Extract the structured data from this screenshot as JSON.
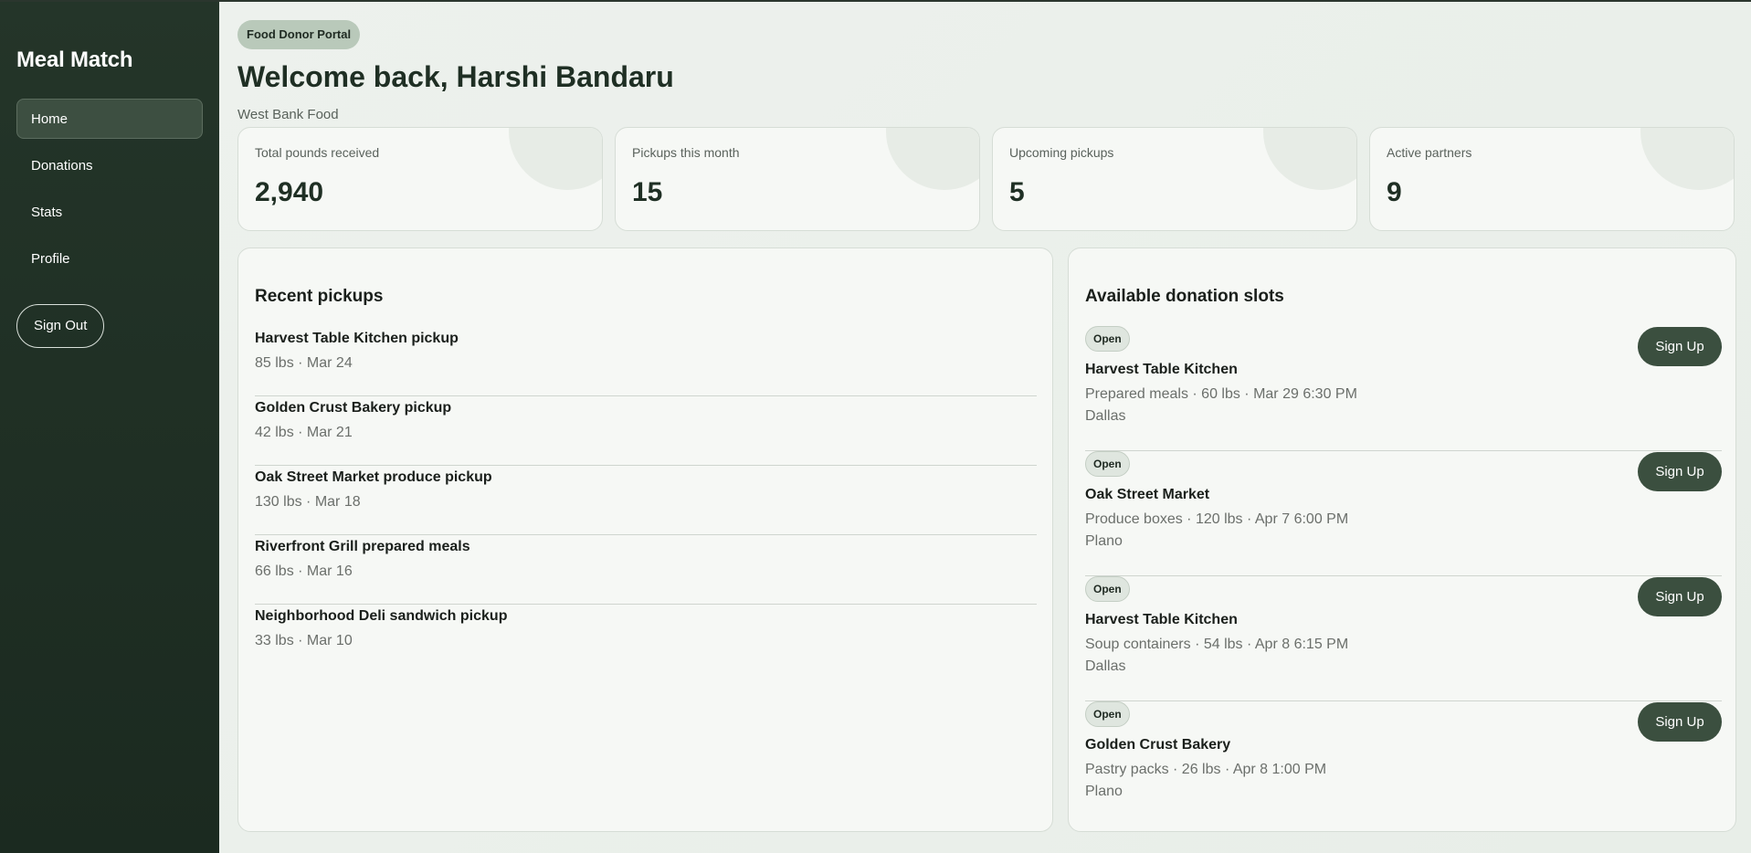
{
  "sidebar": {
    "brand": "Meal Match",
    "nav": [
      {
        "label": "Home"
      },
      {
        "label": "Donations"
      },
      {
        "label": "Stats"
      },
      {
        "label": "Profile"
      }
    ],
    "sign_out": "Sign Out"
  },
  "header": {
    "portal_badge": "Food Donor Portal",
    "welcome": "Welcome back, Harshi Bandaru",
    "organization": "West Bank Food"
  },
  "stats": [
    {
      "label": "Total pounds received",
      "value": "2,940"
    },
    {
      "label": "Pickups this month",
      "value": "15"
    },
    {
      "label": "Upcoming pickups",
      "value": "5"
    },
    {
      "label": "Active partners",
      "value": "9"
    }
  ],
  "recent_pickups": {
    "title": "Recent pickups",
    "items": [
      {
        "title": "Harvest Table Kitchen pickup",
        "meta": "85 lbs · Mar 24"
      },
      {
        "title": "Golden Crust Bakery pickup",
        "meta": "42 lbs · Mar 21"
      },
      {
        "title": "Oak Street Market produce pickup",
        "meta": "130 lbs · Mar 18"
      },
      {
        "title": "Riverfront Grill prepared meals",
        "meta": "66 lbs · Mar 16"
      },
      {
        "title": "Neighborhood Deli sandwich pickup",
        "meta": "33 lbs · Mar 10"
      }
    ]
  },
  "donation_slots": {
    "title": "Available donation slots",
    "items": [
      {
        "status": "Open",
        "name": "Harvest Table Kitchen",
        "detail": "Prepared meals · 60 lbs · Mar 29 6:30 PM",
        "city": "Dallas",
        "action": "Sign Up"
      },
      {
        "status": "Open",
        "name": "Oak Street Market",
        "detail": "Produce boxes · 120 lbs · Apr 7 6:00 PM",
        "city": "Plano",
        "action": "Sign Up"
      },
      {
        "status": "Open",
        "name": "Harvest Table Kitchen",
        "detail": "Soup containers · 54 lbs · Apr 8 6:15 PM",
        "city": "Dallas",
        "action": "Sign Up"
      },
      {
        "status": "Open",
        "name": "Golden Crust Bakery",
        "detail": "Pastry packs · 26 lbs · Apr 8 1:00 PM",
        "city": "Plano",
        "action": "Sign Up"
      }
    ]
  },
  "colors": {
    "sidebar": "#1f2f24",
    "accent_button": "#3b4f3f",
    "page_background": "#e9eee9"
  }
}
